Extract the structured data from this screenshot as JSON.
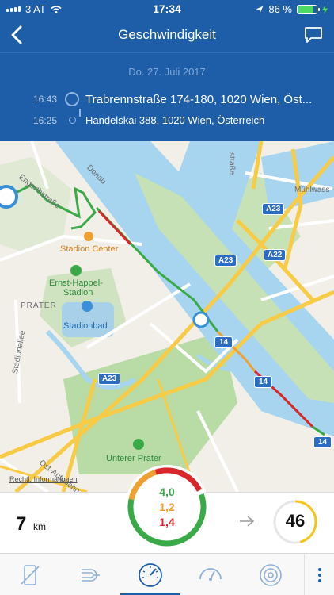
{
  "status_bar": {
    "carrier": "3 AT",
    "time": "17:34",
    "battery": "86 %",
    "battery_level": 0.86
  },
  "header": {
    "title": "Geschwindigkeit"
  },
  "trip": {
    "date": "Do. 27. Juli 2017",
    "end": {
      "time": "16:43",
      "address": "Trabrennstraße 174-180, 1020 Wien, Öst..."
    },
    "start": {
      "time": "16:25",
      "address": "Handelskai 388, 1020 Wien, Österreich"
    }
  },
  "map": {
    "labels": {
      "engerthstrasse": "Engerthstraße",
      "donau": "Donau",
      "muehlwasser": "Mühlwass",
      "stadion_center": "Stadion Center",
      "ernst_happel": "Ernst-Happel-",
      "ernst_happel_2": "Stadion",
      "prater": "PRATER",
      "stadionbad": "Stadionbad",
      "stadionallee": "Stadionallee",
      "unterer_prater": "Unterer Prater",
      "ost_autobahn": "Ost-Autobahn",
      "strasse": "straße"
    },
    "shields": {
      "a23_top": "A23",
      "a23_mid": "A23",
      "a22": "A22",
      "a23_low": "A23",
      "r14_a": "14",
      "r14_b": "14",
      "r14_c": "14"
    },
    "legal": "Rechtl. Informationen"
  },
  "stats": {
    "distance_value": "7",
    "distance_unit": "km",
    "gauge_green": "4,0",
    "gauge_orange": "1,2",
    "gauge_red": "1,4",
    "speed": "46",
    "speed_fraction": 0.46
  },
  "colors": {
    "header_blue": "#1e5ea8",
    "gauge_green": "#3aaa48",
    "gauge_orange": "#f0a030",
    "gauge_red": "#d9262a",
    "speed_ring": "#f5c518"
  },
  "tabs": [
    {
      "icon": "phone-crossed-icon",
      "active": false
    },
    {
      "icon": "magnet-icon",
      "active": false
    },
    {
      "icon": "speedometer-icon",
      "active": true
    },
    {
      "icon": "rpm-gauge-icon",
      "active": false
    },
    {
      "icon": "brake-disc-icon",
      "active": false
    }
  ]
}
